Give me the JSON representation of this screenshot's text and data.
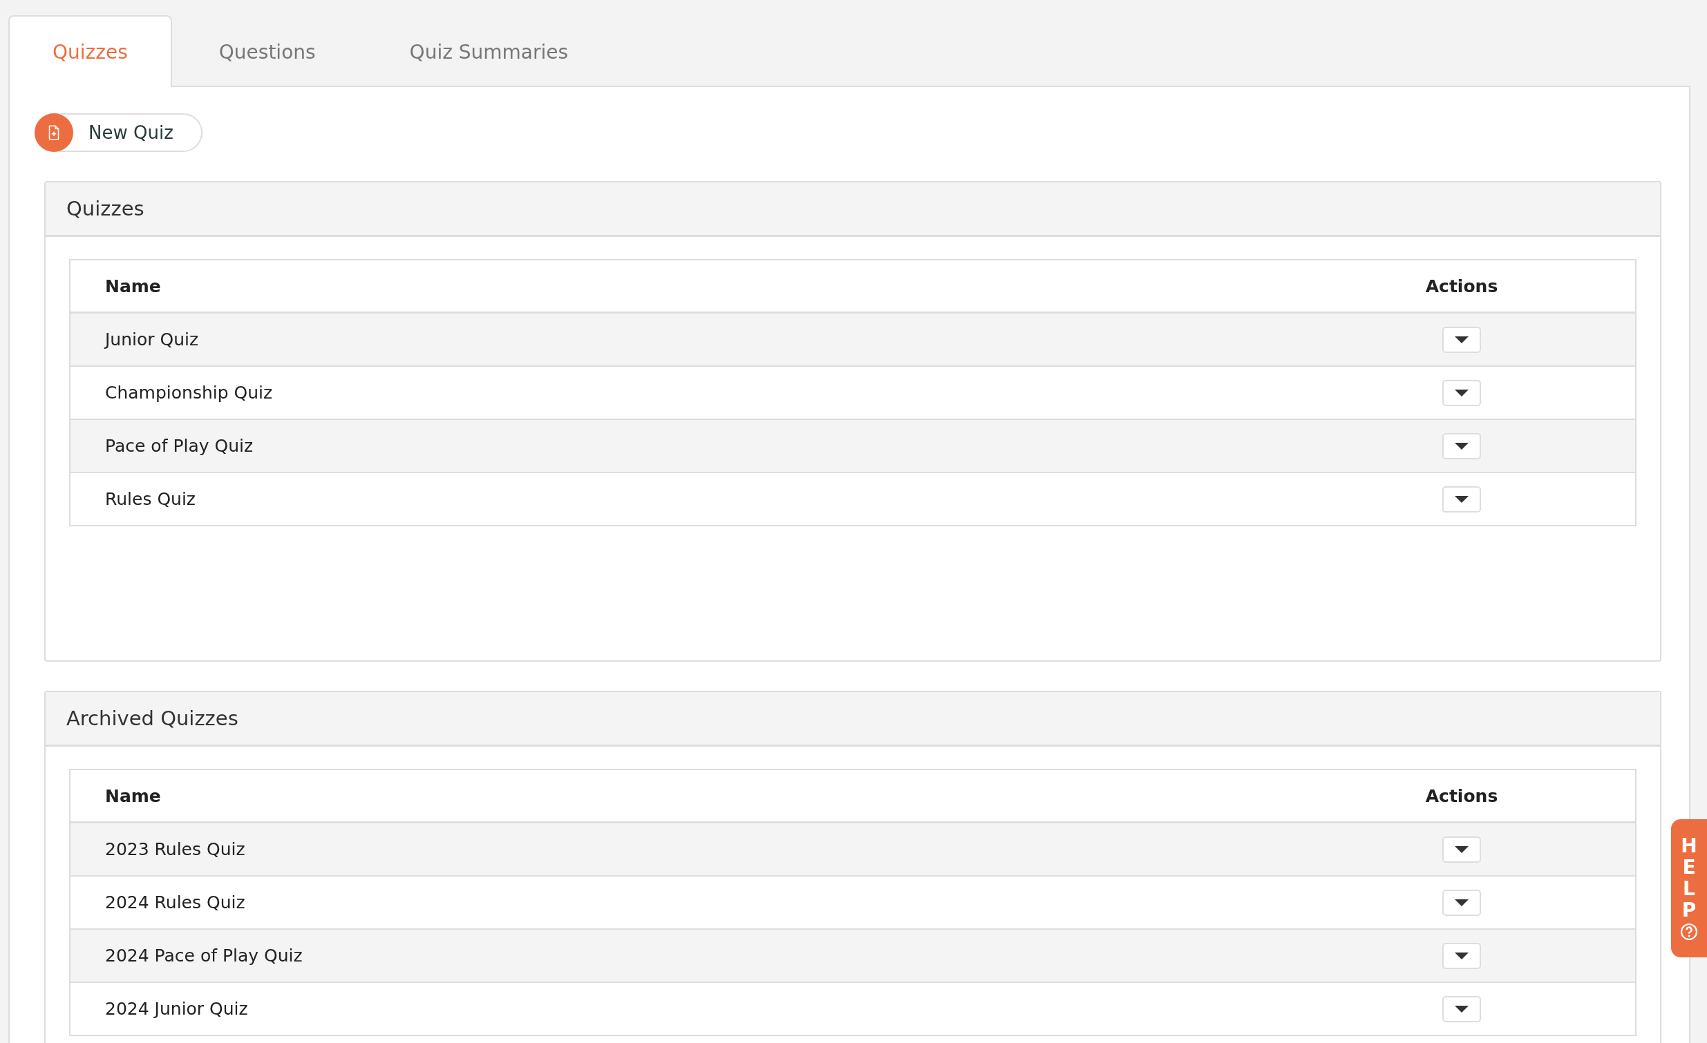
{
  "tabs": [
    {
      "label": "Quizzes",
      "selected": true
    },
    {
      "label": "Questions",
      "selected": false
    },
    {
      "label": "Quiz Summaries",
      "selected": false
    }
  ],
  "new_button": {
    "label": "New Quiz"
  },
  "sections": [
    {
      "title": "Quizzes",
      "columns": [
        "Name",
        "Actions"
      ],
      "rows": [
        {
          "name": "Junior Quiz"
        },
        {
          "name": "Championship Quiz"
        },
        {
          "name": "Pace of Play Quiz"
        },
        {
          "name": "Rules Quiz"
        }
      ]
    },
    {
      "title": "Archived Quizzes",
      "columns": [
        "Name",
        "Actions"
      ],
      "rows": [
        {
          "name": "2023 Rules Quiz"
        },
        {
          "name": "2024 Rules Quiz"
        },
        {
          "name": "2024 Pace of Play Quiz"
        },
        {
          "name": "2024 Junior Quiz"
        }
      ]
    }
  ],
  "help_tab": {
    "label": "HELP"
  }
}
